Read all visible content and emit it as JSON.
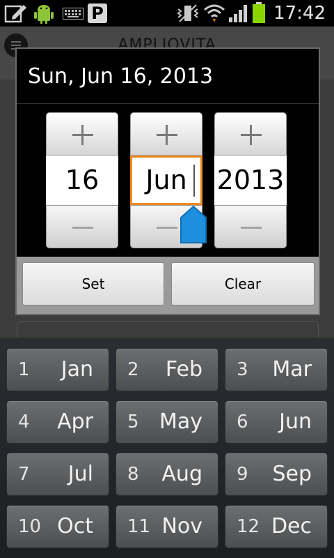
{
  "status_bar": {
    "time": "17:42",
    "icons": [
      "edit-icon",
      "android-icon",
      "keyboard-icon",
      "pinterest-icon",
      "vibrate-icon",
      "wifi-icon",
      "signal-icon",
      "battery-icon"
    ],
    "p_glyph": "P",
    "battery_color": "#8ad500"
  },
  "background_app": {
    "title": "AMPLIOVITA"
  },
  "dialog": {
    "title": "Sun, Jun 16, 2013",
    "day": "16",
    "month": "Jun",
    "year": "2013",
    "focused_field": "month",
    "focus_color": "#ef8a1e",
    "handle_color": "#1e8fdc",
    "buttons": {
      "set": "Set",
      "clear": "Clear"
    }
  },
  "keyboard": {
    "keys": [
      {
        "num": "1",
        "name": "Jan"
      },
      {
        "num": "2",
        "name": "Feb"
      },
      {
        "num": "3",
        "name": "Mar"
      },
      {
        "num": "4",
        "name": "Apr"
      },
      {
        "num": "5",
        "name": "May"
      },
      {
        "num": "6",
        "name": "Jun"
      },
      {
        "num": "7",
        "name": "Jul"
      },
      {
        "num": "8",
        "name": "Aug"
      },
      {
        "num": "9",
        "name": "Sep"
      },
      {
        "num": "10",
        "name": "Oct"
      },
      {
        "num": "11",
        "name": "Nov"
      },
      {
        "num": "12",
        "name": "Dec"
      }
    ]
  }
}
